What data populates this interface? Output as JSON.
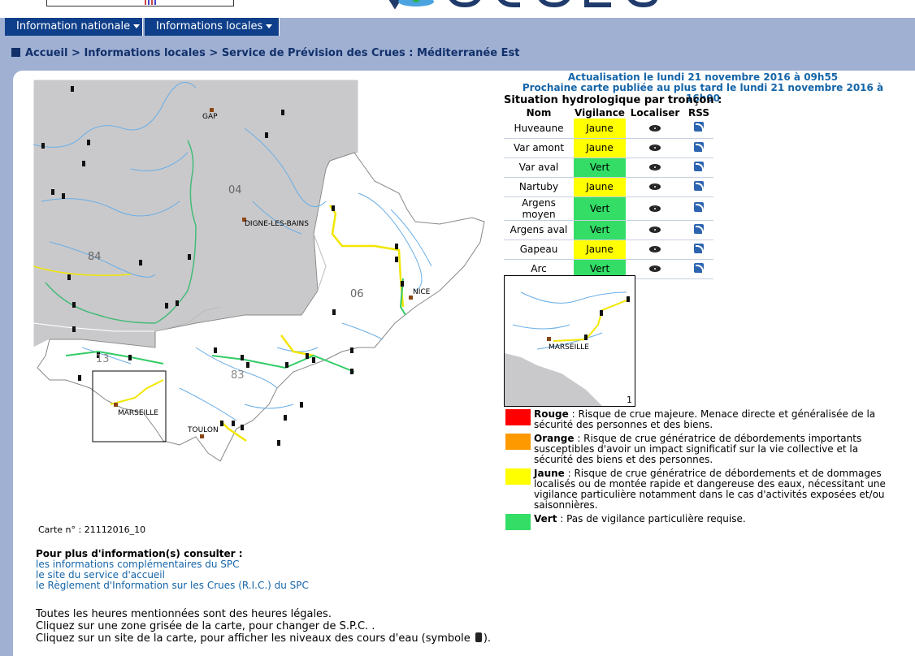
{
  "nav": {
    "item1": "Information nationale",
    "item2": "Informations locales"
  },
  "breadcrumb": {
    "home": "Accueil",
    "level1": "Informations locales",
    "level2": "Service de Prévision des Crues : Méditerranée Est",
    "sep": ">"
  },
  "update": {
    "line1": "Actualisation le lundi 21 novembre 2016 à 09h55",
    "line2": "Prochaine carte publiée au plus tard le lundi 21 novembre 2016 à 16h00"
  },
  "situation_title": "Situation hydrologique par tronçon :",
  "table": {
    "headers": [
      "Nom",
      "Vigilance",
      "Localiser",
      "RSS"
    ],
    "rows": [
      {
        "name": "Huveaune",
        "level": "Jaune"
      },
      {
        "name": "Var amont",
        "level": "Jaune"
      },
      {
        "name": "Var aval",
        "level": "Vert"
      },
      {
        "name": "Nartuby",
        "level": "Jaune"
      },
      {
        "name": "Argens moyen",
        "level": "Vert"
      },
      {
        "name": "Argens aval",
        "level": "Vert"
      },
      {
        "name": "Gapeau",
        "level": "Jaune"
      },
      {
        "name": "Arc",
        "level": "Vert"
      }
    ]
  },
  "colors": {
    "rouge": "#ff0000",
    "orange": "#ff9900",
    "jaune": "#ffff00",
    "vert": "#33dd66",
    "nav_bg": "#0f3f8a",
    "link": "#1565a8"
  },
  "map": {
    "labels": {
      "gap": "GAP",
      "dept04": "04",
      "digne": "DIGNE-LES-BAINS",
      "dept84": "84",
      "dept06": "06",
      "nice": "NICE",
      "dept13": "13",
      "dept83": "83",
      "marseille": "MARSEILLE",
      "toulon": "TOULON"
    }
  },
  "minimap": {
    "city": "MARSEILLE",
    "number": "1"
  },
  "legend": [
    {
      "key": "Rouge",
      "text": " : Risque de crue majeure. Menace directe et généralisée de la sécurité des personnes et des biens."
    },
    {
      "key": "Orange",
      "text": " : Risque de crue génératrice de débordements importants susceptibles d'avoir un impact significatif sur la vie collective et la sécurité des biens et des personnes."
    },
    {
      "key": "Jaune",
      "text": " : Risque de crue génératrice de débordements et de dommages localisés ou de montée rapide et dangereuse des eaux, nécessitant une vigilance particulière notamment dans le cas d'activités exposées et/ou saisonnières."
    },
    {
      "key": "Vert",
      "text": " : Pas de vigilance particulière requise."
    }
  ],
  "carte_num": "Carte n° : 21112016_10",
  "info": {
    "header": "Pour plus d'information(s) consulter :",
    "links": [
      "les informations complémentaires du SPC",
      "le site du service d'accueil",
      "le Règlement d'Information sur les Crues (R.I.C.) du SPC"
    ]
  },
  "notes": {
    "line1": "Toutes les heures mentionnées sont des heures légales.",
    "line2": "Cliquez sur une zone grisée de la carte, pour changer de S.P.C. .",
    "line3a": "Cliquez sur un site de la carte, pour afficher les niveaux des cours d'eau (symbole ",
    "line3b": ")."
  }
}
